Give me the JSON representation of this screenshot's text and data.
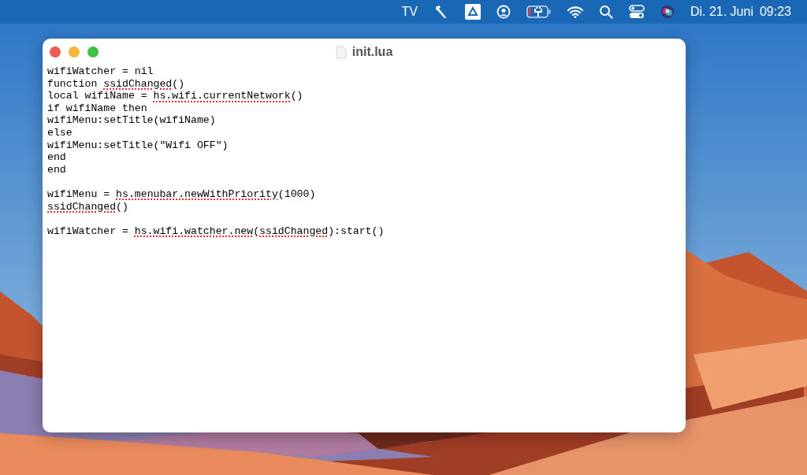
{
  "menubar": {
    "items": [
      {
        "kind": "text",
        "label": "TV"
      },
      {
        "kind": "hammer"
      },
      {
        "kind": "drive"
      },
      {
        "kind": "user"
      },
      {
        "kind": "battery"
      },
      {
        "kind": "wifi"
      },
      {
        "kind": "search"
      },
      {
        "kind": "control"
      },
      {
        "kind": "siri"
      }
    ],
    "date": "Di. 21. Juni",
    "time": "09:23"
  },
  "window": {
    "title": "init.lua",
    "lines": [
      {
        "segments": [
          {
            "text": "wifiWatcher = nil",
            "misspelled": false
          }
        ]
      },
      {
        "segments": [
          {
            "text": "function ",
            "misspelled": false
          },
          {
            "text": "ssidChanged",
            "misspelled": true
          },
          {
            "text": "()",
            "misspelled": false
          }
        ]
      },
      {
        "segments": [
          {
            "text": "local wifiName = ",
            "misspelled": false
          },
          {
            "text": "hs.wifi.currentNetwork",
            "misspelled": true
          },
          {
            "text": "()",
            "misspelled": false
          }
        ]
      },
      {
        "segments": [
          {
            "text": "if wifiName then",
            "misspelled": false
          }
        ]
      },
      {
        "segments": [
          {
            "text": "wifiMenu:setTitle(wifiName)",
            "misspelled": false
          }
        ]
      },
      {
        "segments": [
          {
            "text": "else",
            "misspelled": false
          }
        ]
      },
      {
        "segments": [
          {
            "text": "wifiMenu:setTitle(\"Wifi OFF\")",
            "misspelled": false
          }
        ]
      },
      {
        "segments": [
          {
            "text": "end",
            "misspelled": false
          }
        ]
      },
      {
        "segments": [
          {
            "text": "end",
            "misspelled": false
          }
        ]
      },
      {
        "kind": "blank"
      },
      {
        "segments": [
          {
            "text": "wifiMenu = ",
            "misspelled": false
          },
          {
            "text": "hs.menubar.newWithPriority",
            "misspelled": true
          },
          {
            "text": "(1000)",
            "misspelled": false
          }
        ]
      },
      {
        "segments": [
          {
            "text": "ssidChanged",
            "misspelled": true
          },
          {
            "text": "()",
            "misspelled": false
          }
        ]
      },
      {
        "kind": "blank"
      },
      {
        "segments": [
          {
            "text": "wifiWatcher = ",
            "misspelled": false
          },
          {
            "text": "hs.wifi.watcher.new",
            "misspelled": true
          },
          {
            "text": "(",
            "misspelled": false
          },
          {
            "text": "ssidChanged",
            "misspelled": true
          },
          {
            "text": "):start()",
            "misspelled": false
          }
        ]
      }
    ]
  }
}
